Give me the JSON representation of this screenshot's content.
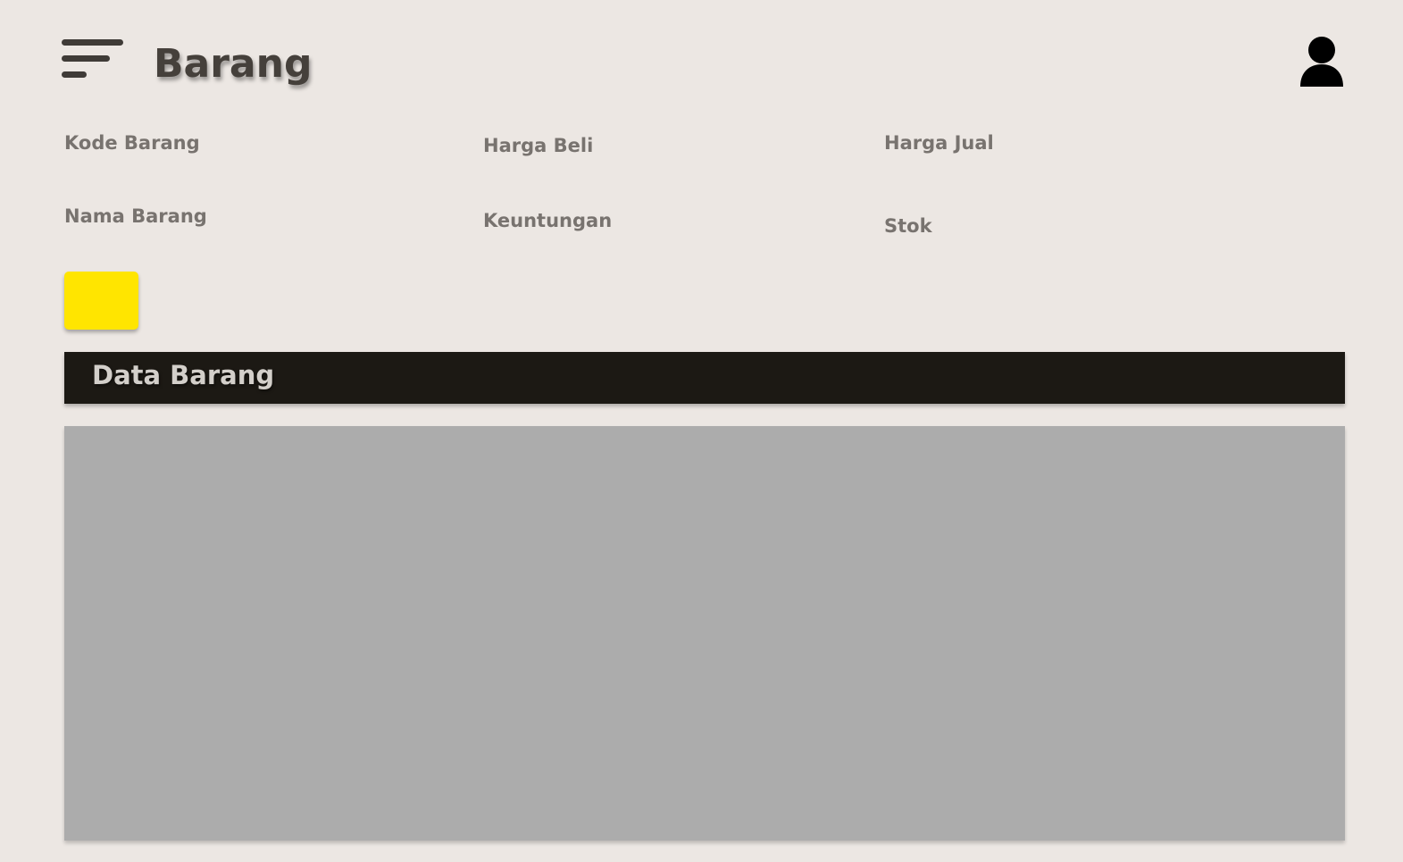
{
  "header": {
    "title": "Barang",
    "menu_icon": "hamburger-menu-icon",
    "user_icon": "user-icon"
  },
  "form": {
    "labels": {
      "kode_barang": "Kode Barang",
      "harga_beli": "Harga Beli",
      "harga_jual": "Harga Jual",
      "nama_barang": "Nama Barang",
      "keuntungan": "Keuntungan",
      "stok": "Stok"
    },
    "save_button_color": "#ffe500"
  },
  "data_section": {
    "title": "Data Barang"
  },
  "colors": {
    "background": "#ece7e3",
    "header_bar": "#1c1914",
    "table_area": "#acacac",
    "accent": "#ffe500"
  }
}
